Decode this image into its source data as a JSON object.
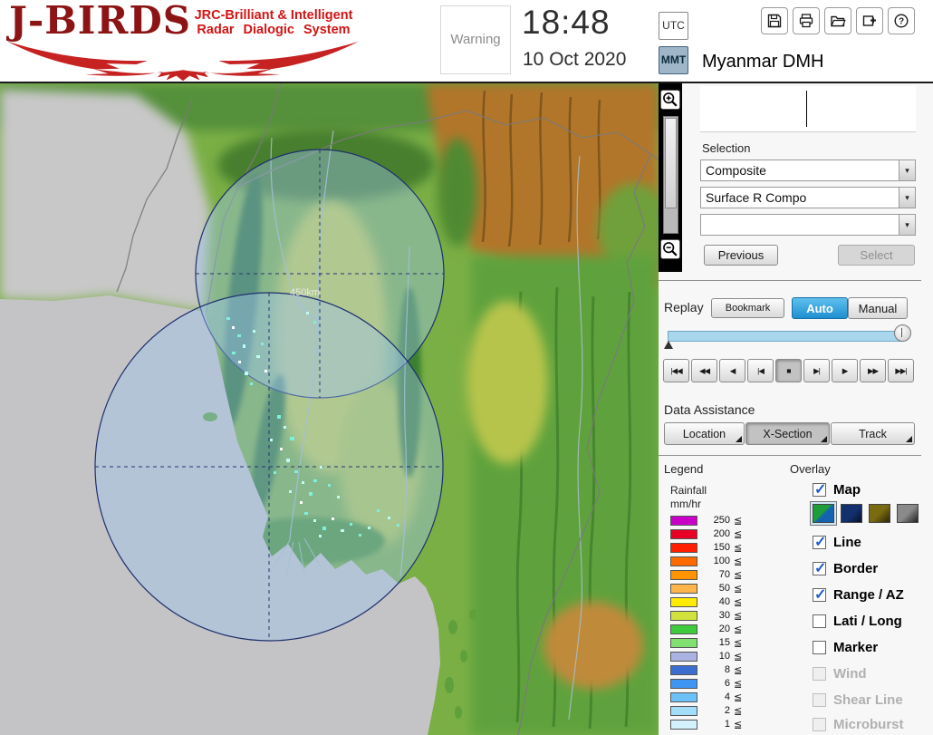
{
  "header": {
    "logo": {
      "title": "J-BIRDS",
      "tagline1": "JRC-Brilliant & Intelligent",
      "tagline2": "Radar  Dialogic  System"
    },
    "warning": "Warning",
    "time": "18:48",
    "date": "10 Oct 2020",
    "tz": {
      "utc": "UTC",
      "mmt": "MMT",
      "selected": "MMT"
    },
    "station": "Myanmar DMH",
    "toolbar": {
      "icons": [
        "save-icon",
        "print-icon",
        "open-folder-icon",
        "add-window-icon",
        "help-icon"
      ],
      "help_glyph": "?"
    }
  },
  "map": {
    "range_label": "450km"
  },
  "zoom": {
    "icons": [
      "zoom-in-icon",
      "zoom-out-icon"
    ]
  },
  "selection": {
    "label": "Selection",
    "dropdown1": "Composite",
    "dropdown2": "Surface R Compo",
    "dropdown3": "",
    "arrow": "▾",
    "previous": "Previous",
    "select": "Select"
  },
  "replay": {
    "label": "Replay",
    "bookmark": "Bookmark",
    "auto": "Auto",
    "manual": "Manual",
    "active_mode": "Auto",
    "playback": [
      "|◀◀",
      "◀◀",
      "◀",
      "|◀",
      "■",
      "▶|",
      "▶",
      "▶▶",
      "▶▶|"
    ],
    "active_playback": "■"
  },
  "assistance": {
    "label": "Data Assistance",
    "location": "Location",
    "xsection": "X-Section",
    "track": "Track",
    "active": "X-Section"
  },
  "legend": {
    "label": "Legend",
    "unit_line1": "Rainfall",
    "unit_line2": "mm/hr",
    "operator": "≦",
    "scale": [
      {
        "value": "250",
        "color": "#C800C8"
      },
      {
        "value": "200",
        "color": "#E80026"
      },
      {
        "value": "150",
        "color": "#FF1E00"
      },
      {
        "value": "100",
        "color": "#FF6A00"
      },
      {
        "value": "70",
        "color": "#FF9300"
      },
      {
        "value": "50",
        "color": "#FFB54A"
      },
      {
        "value": "40",
        "color": "#FFEB00"
      },
      {
        "value": "30",
        "color": "#D2E23C"
      },
      {
        "value": "20",
        "color": "#3DCB3D"
      },
      {
        "value": "15",
        "color": "#80E070"
      },
      {
        "value": "10",
        "color": "#AAB2E2"
      },
      {
        "value": "8",
        "color": "#3C6ED2"
      },
      {
        "value": "6",
        "color": "#3F95F2"
      },
      {
        "value": "4",
        "color": "#6CC2F8"
      },
      {
        "value": "2",
        "color": "#A2DDFB"
      },
      {
        "value": "1",
        "color": "#D2F1FD"
      }
    ]
  },
  "overlay": {
    "label": "Overlay",
    "items": [
      {
        "label": "Map",
        "checked": true,
        "enabled": true
      },
      {
        "label": "Line",
        "checked": true,
        "enabled": true
      },
      {
        "label": "Border",
        "checked": true,
        "enabled": true
      },
      {
        "label": "Range / AZ",
        "checked": true,
        "enabled": true
      },
      {
        "label": "Lati / Long",
        "checked": false,
        "enabled": true
      },
      {
        "label": "Marker",
        "checked": false,
        "enabled": true
      },
      {
        "label": "Wind",
        "checked": false,
        "enabled": false
      },
      {
        "label": "Shear Line",
        "checked": false,
        "enabled": false
      },
      {
        "label": "Microburst",
        "checked": false,
        "enabled": false
      }
    ],
    "map_styles": [
      "map-style-terrain",
      "map-style-dark-blue",
      "map-style-olive",
      "map-style-gray"
    ],
    "selected_map_style": 0
  },
  "colors": {
    "auto_active_bg": "#2D9FD8",
    "slider_track": "#A9D6EC",
    "check_color": "#1E5AC8"
  }
}
